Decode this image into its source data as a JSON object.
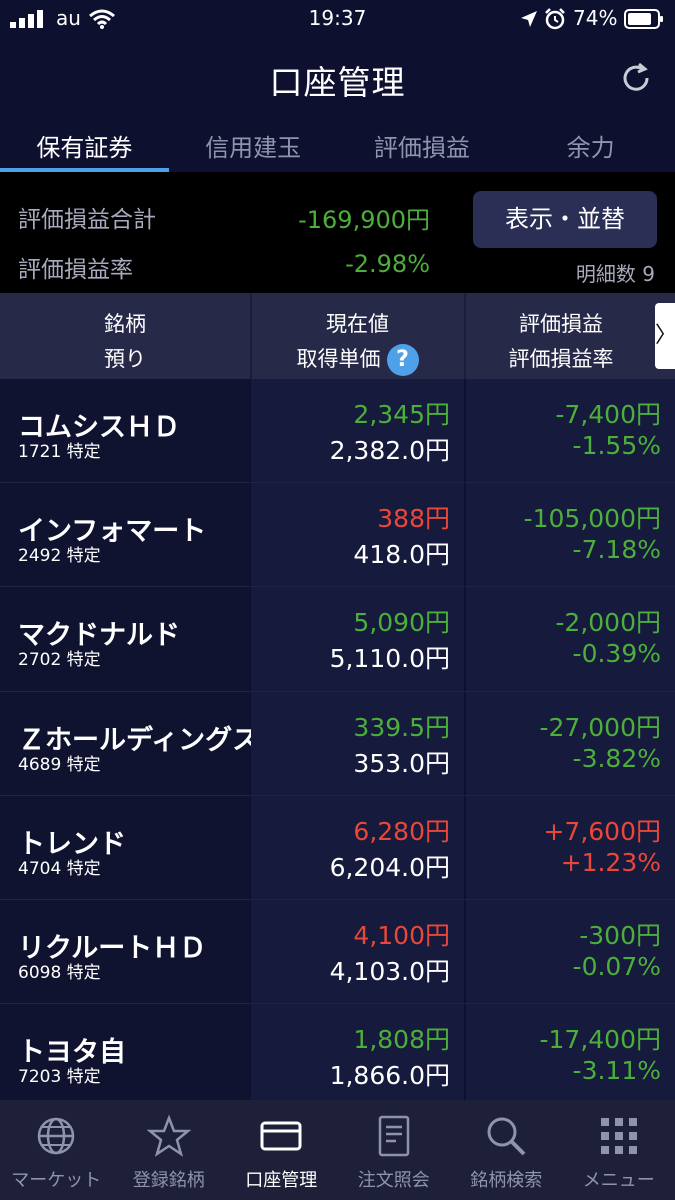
{
  "status_bar": {
    "carrier": "au",
    "time": "19:37",
    "battery": "74%"
  },
  "header": {
    "title": "口座管理"
  },
  "tabs": [
    {
      "label": "保有証券",
      "active": true
    },
    {
      "label": "信用建玉",
      "active": false
    },
    {
      "label": "評価損益",
      "active": false
    },
    {
      "label": "余力",
      "active": false
    }
  ],
  "summary": {
    "total_label": "評価損益合計",
    "total_value": "-169,900円",
    "rate_label": "評価損益率",
    "rate_value": "-2.98%",
    "display_button": "表示・並替",
    "detail_count_label": "明細数",
    "detail_count": "9"
  },
  "table_header": {
    "col1_line1": "銘柄",
    "col1_line2": "預り",
    "col2_line1": "現在値",
    "col2_line2": "取得単価",
    "col3_line1": "評価損益",
    "col3_line2": "評価損益率",
    "help": "?",
    "scroll": "〉"
  },
  "holdings": [
    {
      "name": "コムシスＨＤ",
      "code": "1721 特定",
      "current_price": "2,345円",
      "acquisition_price": "2,382.0円",
      "pl": "-7,400円",
      "pl_rate": "-1.55%",
      "price_color": "green",
      "pl_color": "green"
    },
    {
      "name": "インフォマート",
      "code": "2492 特定",
      "current_price": "388円",
      "acquisition_price": "418.0円",
      "pl": "-105,000円",
      "pl_rate": "-7.18%",
      "price_color": "red",
      "pl_color": "green"
    },
    {
      "name": "マクドナルド",
      "code": "2702 特定",
      "current_price": "5,090円",
      "acquisition_price": "5,110.0円",
      "pl": "-2,000円",
      "pl_rate": "-0.39%",
      "price_color": "green",
      "pl_color": "green"
    },
    {
      "name": "Ｚホールディングス",
      "code": "4689 特定",
      "current_price": "339.5円",
      "acquisition_price": "353.0円",
      "pl": "-27,000円",
      "pl_rate": "-3.82%",
      "price_color": "green",
      "pl_color": "green"
    },
    {
      "name": "トレンド",
      "code": "4704 特定",
      "current_price": "6,280円",
      "acquisition_price": "6,204.0円",
      "pl": "+7,600円",
      "pl_rate": "+1.23%",
      "price_color": "red",
      "pl_color": "red"
    },
    {
      "name": "リクルートＨＤ",
      "code": "6098 特定",
      "current_price": "4,100円",
      "acquisition_price": "4,103.0円",
      "pl": "-300円",
      "pl_rate": "-0.07%",
      "price_color": "red",
      "pl_color": "green"
    },
    {
      "name": "トヨタ自",
      "code": "7203 特定",
      "current_price": "1,808円",
      "acquisition_price": "1,866.0円",
      "pl": "-17,400円",
      "pl_rate": "-3.11%",
      "price_color": "green",
      "pl_color": "green"
    }
  ],
  "bottom_nav": [
    {
      "label": "マーケット",
      "icon": "globe-icon",
      "active": false
    },
    {
      "label": "登録銘柄",
      "icon": "star-icon",
      "active": false
    },
    {
      "label": "口座管理",
      "icon": "card-icon",
      "active": true
    },
    {
      "label": "注文照会",
      "icon": "document-icon",
      "active": false
    },
    {
      "label": "銘柄検索",
      "icon": "search-icon",
      "active": false
    },
    {
      "label": "メニュー",
      "icon": "grid-icon",
      "active": false
    }
  ],
  "colors": {
    "up": "#e8473a",
    "down": "#4caf3a",
    "accent": "#4ea0e8",
    "background": "#0e1030"
  }
}
